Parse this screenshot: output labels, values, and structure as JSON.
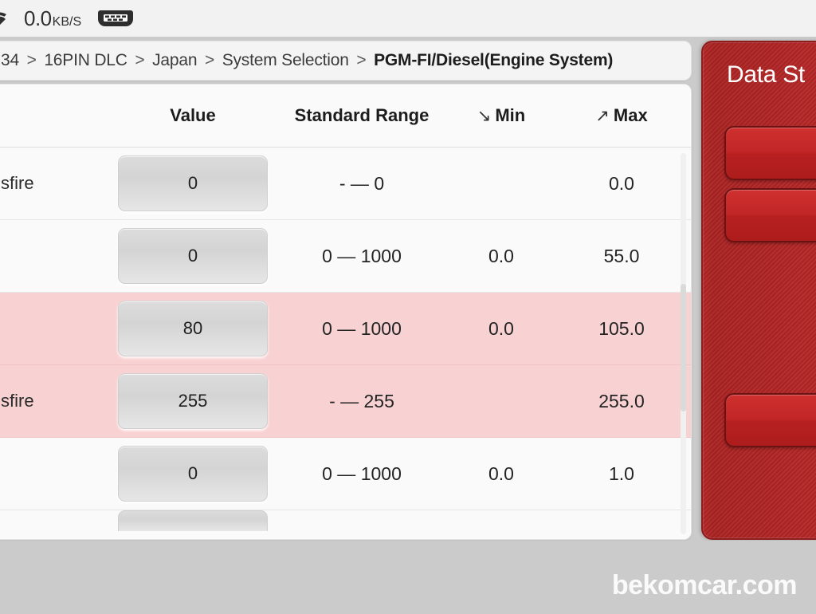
{
  "status_bar": {
    "wifi_icon": "wifi-icon",
    "network_speed_value": "0.0",
    "network_speed_unit": "KB/S",
    "connector_icon": "obd-connector-icon"
  },
  "breadcrumb": {
    "truncated_prefix": "34",
    "items": [
      {
        "label": "34",
        "current": false
      },
      {
        "label": "16PIN DLC",
        "current": false
      },
      {
        "label": "Japan",
        "current": false
      },
      {
        "label": "System Selection",
        "current": false
      },
      {
        "label": "PGM-FI/Diesel(Engine System)",
        "current": true
      }
    ],
    "separator": ">"
  },
  "table": {
    "headers": {
      "name": "",
      "value": "Value",
      "range": "Standard Range",
      "min": "Min",
      "max": "Max",
      "min_arrow": "↘",
      "max_arrow": "↗"
    },
    "rows": [
      {
        "name": "sfire",
        "value": "0",
        "range": "- — 0",
        "min": "",
        "max": "0.0",
        "highlight": false,
        "partial": false
      },
      {
        "name": "",
        "value": "0",
        "range": "0 — 1000",
        "min": "0.0",
        "max": "55.0",
        "highlight": false,
        "partial": false
      },
      {
        "name": "",
        "value": "80",
        "range": "0 — 1000",
        "min": "0.0",
        "max": "105.0",
        "highlight": true,
        "partial": false
      },
      {
        "name": "sfire",
        "value": "255",
        "range": "- — 255",
        "min": "",
        "max": "255.0",
        "highlight": true,
        "partial": false
      },
      {
        "name": "",
        "value": "0",
        "range": "0 — 1000",
        "min": "0.0",
        "max": "1.0",
        "highlight": false,
        "partial": false
      },
      {
        "name": "",
        "value": "",
        "range": "",
        "min": "",
        "max": "",
        "highlight": false,
        "partial": true
      }
    ]
  },
  "side_panel": {
    "title": "Data St",
    "buttons": [
      {
        "label": ""
      },
      {
        "label": ""
      },
      {
        "label": ""
      }
    ],
    "accent_color": "#b22626",
    "button_color": "#c22626"
  },
  "watermark": {
    "text": "bekomcar.com"
  },
  "colors": {
    "highlight_row": "#f8d2d2",
    "panel_red": "#b22626",
    "page_background": "#cbcbcb"
  }
}
